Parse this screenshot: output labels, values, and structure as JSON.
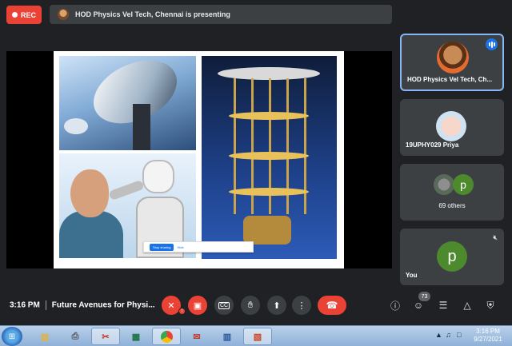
{
  "recording": {
    "label": "REC",
    "color": "#ea4335"
  },
  "presenting_bar": {
    "text": "HOD Physics Vel Tech, Chennai is presenting"
  },
  "screen_share": {
    "stop_label": "Stop sharing",
    "hide_label": "Hide"
  },
  "participants": [
    {
      "name": "HOD Physics Vel Tech, Ch...",
      "speaking": true
    },
    {
      "name": "19UPHY029 Priya"
    },
    {
      "name": "69 others",
      "avatar_letter": "p"
    },
    {
      "name": "You",
      "avatar_letter": "p",
      "muted": true
    }
  ],
  "meeting": {
    "time": "3:16 PM",
    "title": "Future Avenues for Physi..."
  },
  "controls": {
    "mic": "mic-off-icon",
    "camera": "camera-off-icon",
    "captions": "captions-icon",
    "raise_hand": "raise-hand-icon",
    "present": "present-icon",
    "more": "more-options-icon",
    "leave": "end-call-icon"
  },
  "right_controls": {
    "people_count": "73"
  },
  "taskbar": {
    "clock_time": "3:16 PM",
    "clock_date": "9/27/2021"
  }
}
